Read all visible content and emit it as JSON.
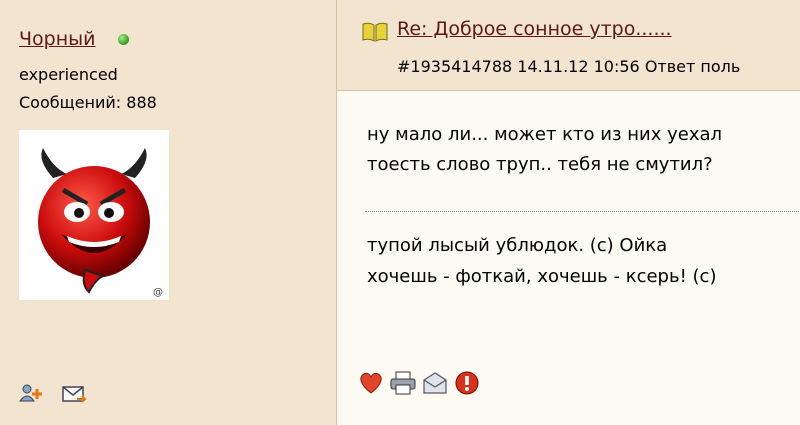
{
  "author": {
    "name": "Чорный",
    "rank": "experienced",
    "posts_label": "Сообщений: 888"
  },
  "post": {
    "title": "Re: Доброе сонное утро......",
    "meta": "#1935414788 14.11.12 10:56  Ответ поль",
    "body_lines": [
      "ну мало ли... может кто из них уехал",
      "тоесть слово труп.. тебя не смутил?"
    ],
    "signature_lines": [
      "тупой лысый ублюдок. (с) Ойка",
      "хочешь - фоткай, хочешь - ксерь! (с)"
    ]
  },
  "colors": {
    "background": "#f2e4cf",
    "post_body": "#fdf9f3",
    "link": "#5c1a10",
    "online": "#2f9a1a"
  },
  "icons": [
    "online-indicator",
    "add-friend-icon",
    "mail-icon",
    "topic-book-icon",
    "heart-icon",
    "print-icon",
    "message-icon",
    "report-icon"
  ]
}
